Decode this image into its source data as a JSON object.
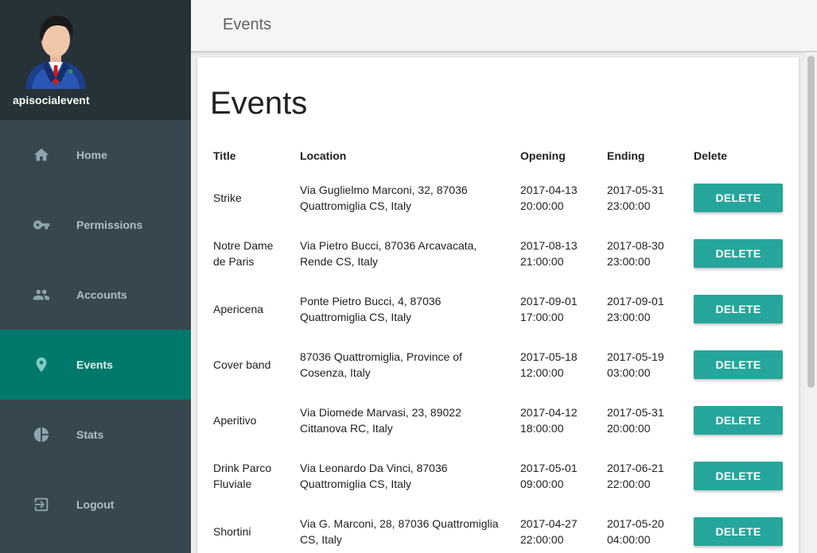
{
  "sidebar": {
    "username": "apisocialevent",
    "items": [
      {
        "label": "Home",
        "icon": "home-icon",
        "active": false
      },
      {
        "label": "Permissions",
        "icon": "key-icon",
        "active": false
      },
      {
        "label": "Accounts",
        "icon": "people-icon",
        "active": false
      },
      {
        "label": "Events",
        "icon": "location-pin-icon",
        "active": true
      },
      {
        "label": "Stats",
        "icon": "pie-chart-icon",
        "active": false
      },
      {
        "label": "Logout",
        "icon": "logout-icon",
        "active": false
      }
    ]
  },
  "header": {
    "title": "Events"
  },
  "main": {
    "title": "Events",
    "columns": [
      "Title",
      "Location",
      "Opening",
      "Ending",
      "Delete"
    ],
    "delete_label": "DELETE",
    "rows": [
      {
        "title": "Strike",
        "location": "Via Guglielmo Marconi, 32, 87036 Quattromiglia CS, Italy",
        "opening_date": "2017-04-13",
        "opening_time": "20:00:00",
        "ending_date": "2017-05-31",
        "ending_time": "23:00:00"
      },
      {
        "title": "Notre Dame de Paris",
        "location": "Via Pietro Bucci, 87036 Arcavacata, Rende CS, Italy",
        "opening_date": "2017-08-13",
        "opening_time": "21:00:00",
        "ending_date": "2017-08-30",
        "ending_time": "23:00:00"
      },
      {
        "title": "Apericena",
        "location": "Ponte Pietro Bucci, 4, 87036 Quattromiglia CS, Italy",
        "opening_date": "2017-09-01",
        "opening_time": "17:00:00",
        "ending_date": "2017-09-01",
        "ending_time": "23:00:00"
      },
      {
        "title": "Cover band",
        "location": "87036 Quattromiglia, Province of Cosenza, Italy",
        "opening_date": "2017-05-18",
        "opening_time": "12:00:00",
        "ending_date": "2017-05-19",
        "ending_time": "03:00:00"
      },
      {
        "title": "Aperitivo",
        "location": "Via Diomede Marvasi, 23, 89022 Cittanova RC, Italy",
        "opening_date": "2017-04-12",
        "opening_time": "18:00:00",
        "ending_date": "2017-05-31",
        "ending_time": "20:00:00"
      },
      {
        "title": "Drink Parco Fluviale",
        "location": "Via Leonardo Da Vinci, 87036 Quattromiglia CS, Italy",
        "opening_date": "2017-05-01",
        "opening_time": "09:00:00",
        "ending_date": "2017-06-21",
        "ending_time": "22:00:00"
      },
      {
        "title": "Shortini",
        "location": "Via G. Marconi, 28, 87036 Quattromiglia CS, Italy",
        "opening_date": "2017-04-27",
        "opening_time": "22:00:00",
        "ending_date": "2017-05-20",
        "ending_time": "04:00:00"
      }
    ]
  },
  "colors": {
    "sidebar_bg": "#37474f",
    "profile_bg": "#263238",
    "active_item": "#00796b",
    "delete_button": "#26a69a"
  }
}
